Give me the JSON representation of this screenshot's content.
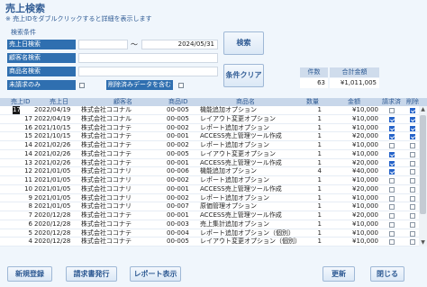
{
  "header": {
    "title": "売上検索",
    "subtitle": "※ 売上IDをダブルクリックすると詳細を表示します"
  },
  "conditions": {
    "section_label": "検索条件",
    "date_label": "売上日検索",
    "date_from": "",
    "date_sep": "～",
    "date_to": "2024/05/31",
    "customer_label": "顧客名検索",
    "customer_value": "",
    "product_label": "商品名検索",
    "product_value": "",
    "unpaid_label": "未請求のみ",
    "unpaid_checked": false,
    "deleted_label": "削除済みデータを含む",
    "deleted_checked": false
  },
  "buttons": {
    "search": "検索",
    "clear": "条件クリア",
    "new": "新規登録",
    "invoice": "請求書発行",
    "report": "レポート表示",
    "refresh": "更新",
    "close": "閉じる"
  },
  "summary": {
    "count_header": "件数",
    "total_header": "合計金額",
    "count": "63",
    "total": "¥1,011,005"
  },
  "columns": [
    "売上ID",
    "売上日",
    "顧客名",
    "商品ID",
    "商品名",
    "数量",
    "金額",
    "請求済",
    "削除"
  ],
  "rows": [
    {
      "id": "17",
      "date": "2022/04/19",
      "customer": "株式会社ココナル",
      "pid": "00-005",
      "pname": "機能追加オプション",
      "qty": "1",
      "amount": "¥10,000",
      "billed": false,
      "deleted": true
    },
    {
      "id": "17",
      "date": "2022/04/19",
      "customer": "株式会社ココナル",
      "pid": "00-005",
      "pname": "レイアウト変更オプション",
      "qty": "1",
      "amount": "¥10,000",
      "billed": true,
      "deleted": true
    },
    {
      "id": "16",
      "date": "2021/10/15",
      "customer": "株式会社ココナテ",
      "pid": "00-002",
      "pname": "レポート追加オプション",
      "qty": "1",
      "amount": "¥10,000",
      "billed": true,
      "deleted": true
    },
    {
      "id": "15",
      "date": "2021/10/15",
      "customer": "株式会社ココナテ",
      "pid": "00-001",
      "pname": "ACCESS売上管理ツール作成",
      "qty": "1",
      "amount": "¥20,000",
      "billed": true,
      "deleted": true
    },
    {
      "id": "14",
      "date": "2021/02/26",
      "customer": "株式会社ココナテ",
      "pid": "00-002",
      "pname": "レポート追加オプション",
      "qty": "1",
      "amount": "¥10,000",
      "billed": false,
      "deleted": false
    },
    {
      "id": "14",
      "date": "2021/02/26",
      "customer": "株式会社ココナテ",
      "pid": "00-005",
      "pname": "レイアウト変更オプション",
      "qty": "1",
      "amount": "¥10,000",
      "billed": true,
      "deleted": false
    },
    {
      "id": "13",
      "date": "2021/02/26",
      "customer": "株式会社ココナテ",
      "pid": "00-001",
      "pname": "ACCESS売上管理ツール作成",
      "qty": "1",
      "amount": "¥20,000",
      "billed": true,
      "deleted": false
    },
    {
      "id": "12",
      "date": "2021/01/05",
      "customer": "株式会社ココナリ",
      "pid": "00-006",
      "pname": "機能追加オプション",
      "qty": "4",
      "amount": "¥40,000",
      "billed": true,
      "deleted": false
    },
    {
      "id": "11",
      "date": "2021/01/05",
      "customer": "株式会社ココナリ",
      "pid": "00-002",
      "pname": "レポート追加オプション",
      "qty": "1",
      "amount": "¥10,000",
      "billed": false,
      "deleted": false
    },
    {
      "id": "10",
      "date": "2021/01/05",
      "customer": "株式会社ココナリ",
      "pid": "00-001",
      "pname": "ACCESS売上管理ツール作成",
      "qty": "1",
      "amount": "¥20,000",
      "billed": false,
      "deleted": false
    },
    {
      "id": "9",
      "date": "2021/01/05",
      "customer": "株式会社ココナリ",
      "pid": "00-002",
      "pname": "レポート追加オプション",
      "qty": "1",
      "amount": "¥10,000",
      "billed": false,
      "deleted": false
    },
    {
      "id": "8",
      "date": "2021/01/05",
      "customer": "株式会社ココナリ",
      "pid": "00-007",
      "pname": "原価管理オプション",
      "qty": "1",
      "amount": "¥10,000",
      "billed": false,
      "deleted": false
    },
    {
      "id": "7",
      "date": "2020/12/28",
      "customer": "株式会社ココナテ",
      "pid": "00-001",
      "pname": "ACCESS売上管理ツール作成",
      "qty": "1",
      "amount": "¥20,000",
      "billed": false,
      "deleted": false
    },
    {
      "id": "6",
      "date": "2020/12/28",
      "customer": "株式会社ココナテ",
      "pid": "00-003",
      "pname": "売上集計追加オプション",
      "qty": "1",
      "amount": "¥10,000",
      "billed": false,
      "deleted": false
    },
    {
      "id": "5",
      "date": "2020/12/28",
      "customer": "株式会社ココナテ",
      "pid": "00-004",
      "pname": "レポート追加オプション（個別）",
      "qty": "1",
      "amount": "¥10,000",
      "billed": false,
      "deleted": false
    },
    {
      "id": "4",
      "date": "2020/12/28",
      "customer": "株式会社ココナテ",
      "pid": "00-005",
      "pname": "レイアウト変更オプション（個別）",
      "qty": "1",
      "amount": "¥10,000",
      "billed": false,
      "deleted": false
    }
  ]
}
